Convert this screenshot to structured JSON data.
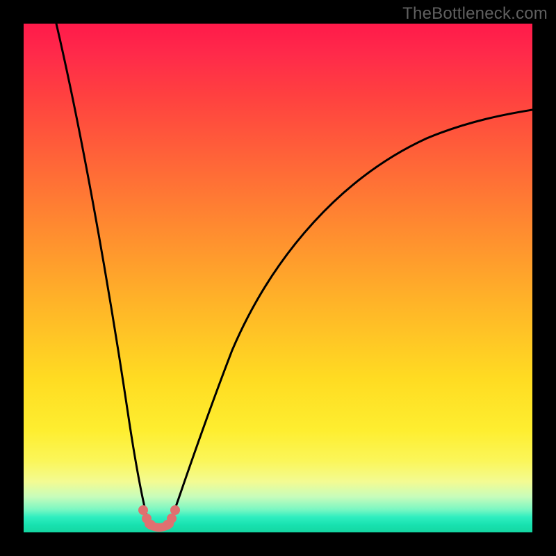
{
  "watermark": "TheBottleneck.com",
  "chart_data": {
    "type": "line",
    "title": "",
    "xlabel": "",
    "ylabel": "",
    "x_range": [
      0,
      732
    ],
    "y_range_top_is_100": true,
    "note": "Decorative bottleneck V-curve; no axes or tick labels are shown. Values estimated from pixel positions; y is percent where top=100 and bottom=0.",
    "series": [
      {
        "name": "left-arm",
        "x": [
          47,
          60,
          75,
          90,
          105,
          120,
          135,
          150,
          160,
          168,
          174,
          180
        ],
        "y": [
          100,
          88,
          74,
          60,
          46,
          33,
          21,
          11,
          6,
          3,
          1.5,
          0.8
        ]
      },
      {
        "name": "right-arm",
        "x": [
          210,
          218,
          228,
          244,
          265,
          295,
          335,
          385,
          445,
          515,
          595,
          680,
          732
        ],
        "y": [
          0.8,
          2,
          4,
          8,
          15,
          25,
          37,
          49,
          59,
          67,
          74,
          80,
          83
        ]
      }
    ],
    "trough": {
      "x_start": 175,
      "x_end": 215,
      "y": 0.5
    },
    "dots": {
      "color": "#e07070",
      "points": [
        {
          "x": 172,
          "y": 4.0
        },
        {
          "x": 176,
          "y": 2.3
        },
        {
          "x": 181,
          "y": 1.1
        },
        {
          "x": 208,
          "y": 1.1
        },
        {
          "x": 213,
          "y": 2.3
        },
        {
          "x": 217,
          "y": 4.0
        }
      ]
    },
    "gradient_stops": [
      {
        "pos": 0,
        "color": "#ff1a4a"
      },
      {
        "pos": 0.4,
        "color": "#ff8a30"
      },
      {
        "pos": 0.8,
        "color": "#feee30"
      },
      {
        "pos": 0.97,
        "color": "#2feec0"
      },
      {
        "pos": 1.0,
        "color": "#14d6a1"
      }
    ]
  }
}
